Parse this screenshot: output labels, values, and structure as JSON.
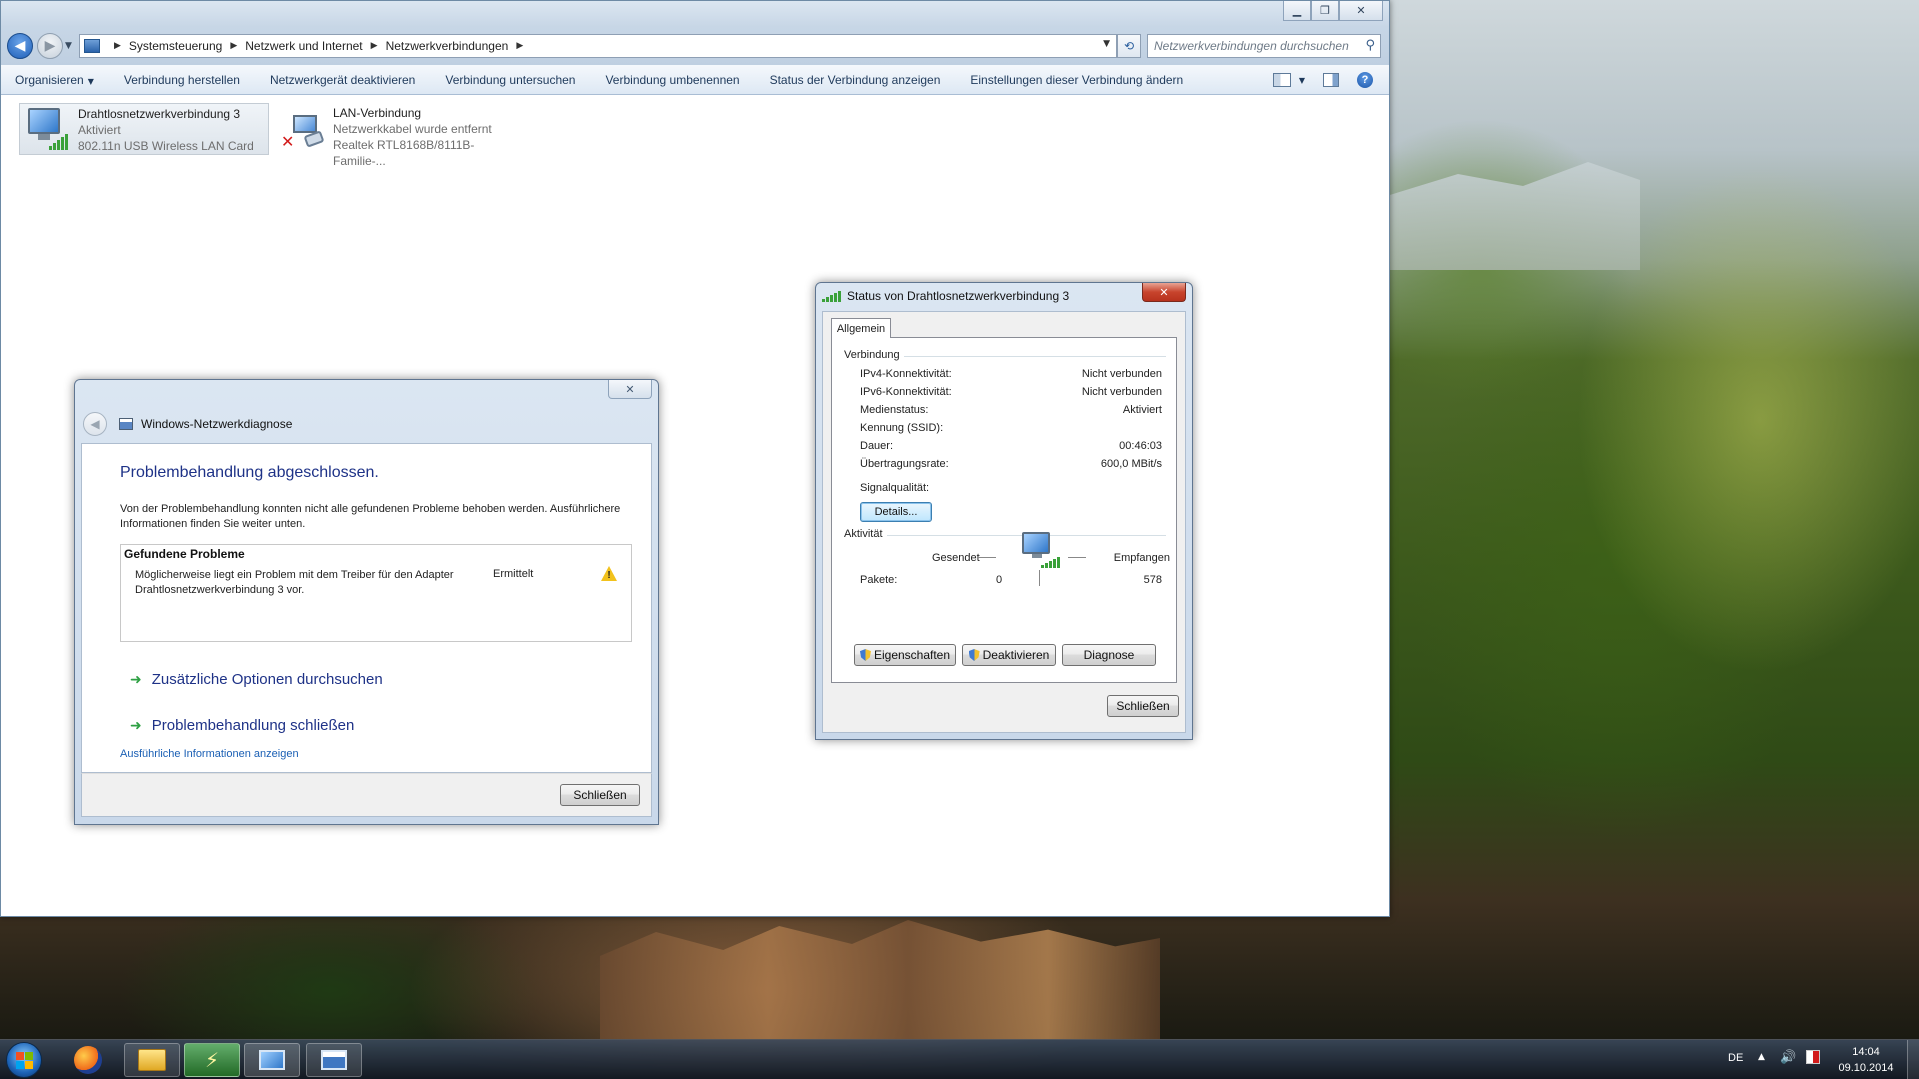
{
  "explorer": {
    "breadcrumbs": [
      "Systemsteuerung",
      "Netzwerk und Internet",
      "Netzwerkverbindungen"
    ],
    "search_placeholder": "Netzwerkverbindungen durchsuchen",
    "commands": {
      "organize": "Organisieren",
      "connect": "Verbindung herstellen",
      "disable": "Netzwerkgerät deaktivieren",
      "diagnose": "Verbindung untersuchen",
      "rename": "Verbindung umbenennen",
      "status": "Status der Verbindung anzeigen",
      "settings": "Einstellungen dieser Verbindung ändern"
    },
    "connections": [
      {
        "name": "Drahtlosnetzwerkverbindung 3",
        "status": "Aktiviert",
        "device": "802.11n USB Wireless LAN Card"
      },
      {
        "name": "LAN-Verbindung",
        "status": "Netzwerkkabel wurde entfernt",
        "device": "Realtek RTL8168B/8111B-Familie-..."
      }
    ]
  },
  "diagnose_dialog": {
    "title": "Windows-Netzwerkdiagnose",
    "heading": "Problembehandlung abgeschlossen.",
    "description": "Von der Problembehandlung konnten nicht alle gefundenen Probleme behoben werden. Ausführlichere Informationen finden Sie weiter unten.",
    "problems_header": "Gefundene Probleme",
    "problem": "Möglicherweise liegt ein Problem mit dem Treiber für den Adapter Drahtlosnetzwerkverbindung 3 vor.",
    "problem_status": "Ermittelt",
    "option_explore": "Zusätzliche Optionen durchsuchen",
    "option_close": "Problembehandlung schließen",
    "details_link": "Ausführliche Informationen anzeigen",
    "close_button": "Schließen"
  },
  "status_dialog": {
    "title": "Status von Drahtlosnetzwerkverbindung 3",
    "tab": "Allgemein",
    "connection_group": "Verbindung",
    "rows": [
      {
        "key": "IPv4-Konnektivität:",
        "value": "Nicht verbunden"
      },
      {
        "key": "IPv6-Konnektivität:",
        "value": "Nicht verbunden"
      },
      {
        "key": "Medienstatus:",
        "value": "Aktiviert"
      },
      {
        "key": "Kennung (SSID):",
        "value": ""
      },
      {
        "key": "Dauer:",
        "value": "00:46:03"
      },
      {
        "key": "Übertragungsrate:",
        "value": "600,0 MBit/s"
      }
    ],
    "signal_label": "Signalqualität:",
    "details_button": "Details...",
    "activity_group": "Aktivität",
    "sent_label": "Gesendet",
    "received_label": "Empfangen",
    "packets_label": "Pakete:",
    "packets_sent": "0",
    "packets_received": "578",
    "properties_button": "Eigenschaften",
    "deactivate_button": "Deaktivieren",
    "diagnose_button": "Diagnose",
    "close_button": "Schließen"
  },
  "taskbar": {
    "language": "DE",
    "time": "14:04",
    "date": "09.10.2014"
  },
  "colors": {
    "link_blue": "#1e3287",
    "signal_green": "#3aa13a",
    "error_red": "#d21b1b"
  }
}
